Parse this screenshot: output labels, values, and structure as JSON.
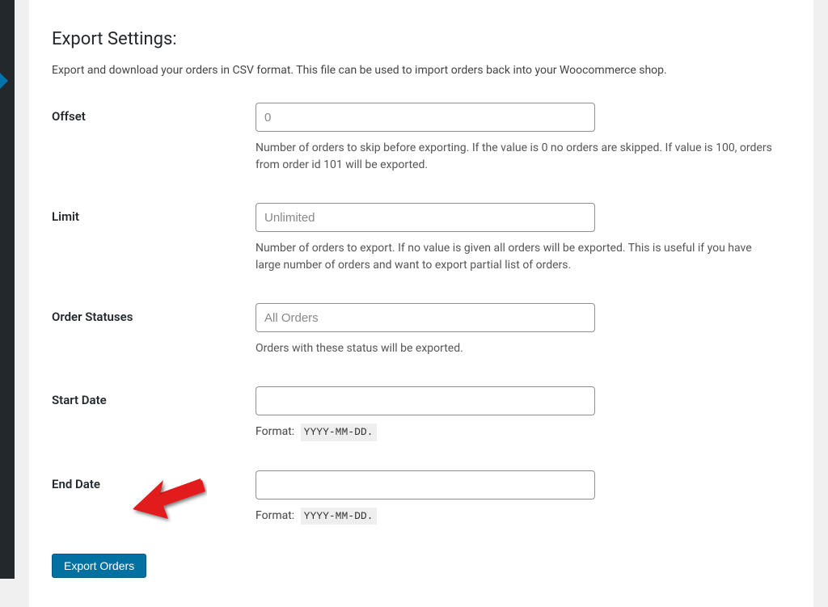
{
  "page": {
    "title": "Export Settings:",
    "description": "Export and download your orders in CSV format. This file can be used to import orders back into your Woocommerce shop."
  },
  "fields": {
    "offset": {
      "label": "Offset",
      "placeholder": "0",
      "value": "",
      "help": "Number of orders to skip before exporting. If the value is 0 no orders are skipped. If value is 100, orders from order id 101 will be exported."
    },
    "limit": {
      "label": "Limit",
      "placeholder": "Unlimited",
      "value": "",
      "help": "Number of orders to export. If no value is given all orders will be exported. This is useful if you have large number of orders and want to export partial list of orders."
    },
    "order_statuses": {
      "label": "Order Statuses",
      "placeholder": "All Orders",
      "value": "",
      "help": "Orders with these status will be exported."
    },
    "start_date": {
      "label": "Start Date",
      "value": "",
      "format_label": "Format:",
      "format_value": "YYYY-MM-DD."
    },
    "end_date": {
      "label": "End Date",
      "value": "",
      "format_label": "Format:",
      "format_value": "YYYY-MM-DD."
    }
  },
  "actions": {
    "export_button": "Export Orders"
  }
}
